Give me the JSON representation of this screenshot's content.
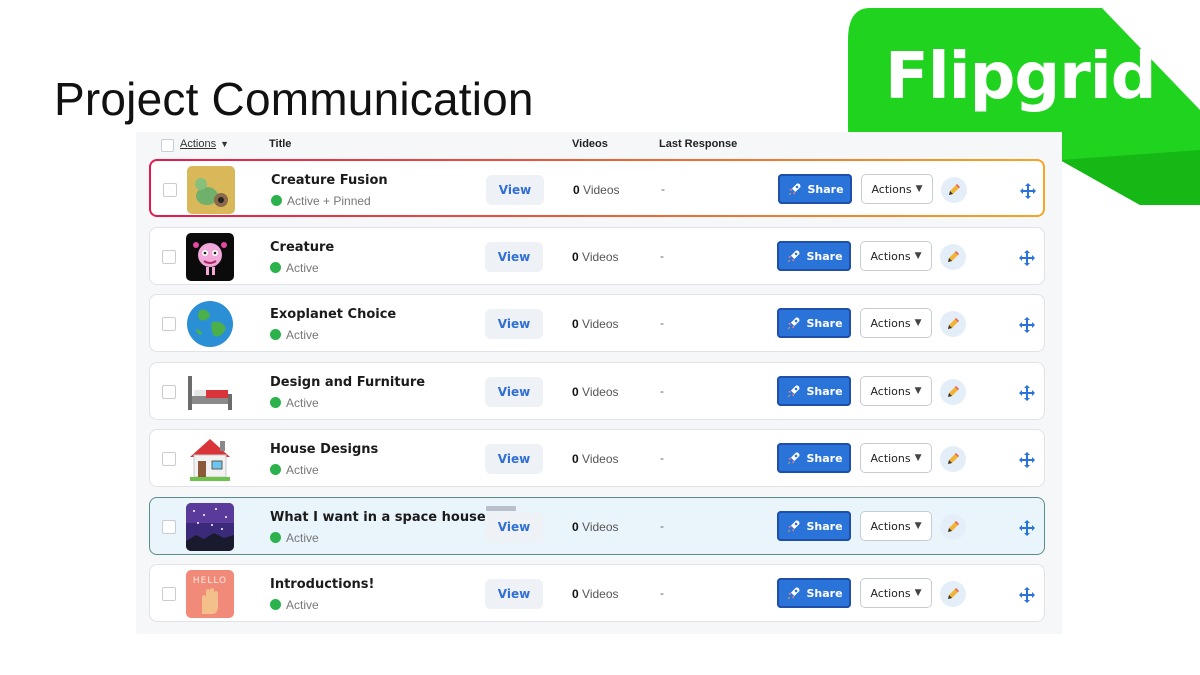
{
  "slide": {
    "title": "Project Communication"
  },
  "logo": {
    "text": "Flipgrid",
    "color": "#1fd31f"
  },
  "table": {
    "headers": {
      "actions": "Actions",
      "title": "Title",
      "videos": "Videos",
      "last_response": "Last Response"
    },
    "rows": [
      {
        "title": "Creature Fusion",
        "status": "Active + Pinned",
        "view": "View",
        "video_count": "0",
        "video_label": "Videos",
        "last_response": "-",
        "share": "Share",
        "actions": "Actions",
        "thumb": "creature-fusion-image"
      },
      {
        "title": "Creature",
        "status": "Active",
        "view": "View",
        "video_count": "0",
        "video_label": "Videos",
        "last_response": "-",
        "share": "Share",
        "actions": "Actions",
        "thumb": "creature-image"
      },
      {
        "title": "Exoplanet Choice",
        "status": "Active",
        "view": "View",
        "video_count": "0",
        "video_label": "Videos",
        "last_response": "-",
        "share": "Share",
        "actions": "Actions",
        "thumb": "earth-globe-image"
      },
      {
        "title": "Design and Furniture",
        "status": "Active",
        "view": "View",
        "video_count": "0",
        "video_label": "Videos",
        "last_response": "-",
        "share": "Share",
        "actions": "Actions",
        "thumb": "bed-image"
      },
      {
        "title": "House Designs",
        "status": "Active",
        "view": "View",
        "video_count": "0",
        "video_label": "Videos",
        "last_response": "-",
        "share": "Share",
        "actions": "Actions",
        "thumb": "house-image"
      },
      {
        "title": "What I want in a space house",
        "status": "Active",
        "view": "View",
        "video_count": "0",
        "video_label": "Videos",
        "last_response": "-",
        "share": "Share",
        "actions": "Actions",
        "thumb": "night-sky-image"
      },
      {
        "title": "Introductions!",
        "status": "Active",
        "view": "View",
        "video_count": "0",
        "video_label": "Videos",
        "last_response": "-",
        "share": "Share",
        "actions": "Actions",
        "thumb": "hello-wave-image",
        "thumb_text": "HELLO"
      }
    ]
  },
  "colors": {
    "share": "#2a73d9",
    "active_dot": "#2bb24c",
    "view_text": "#2f6fd6",
    "pinned_border_start": "#e6184e",
    "pinned_border_end": "#f5a623"
  }
}
